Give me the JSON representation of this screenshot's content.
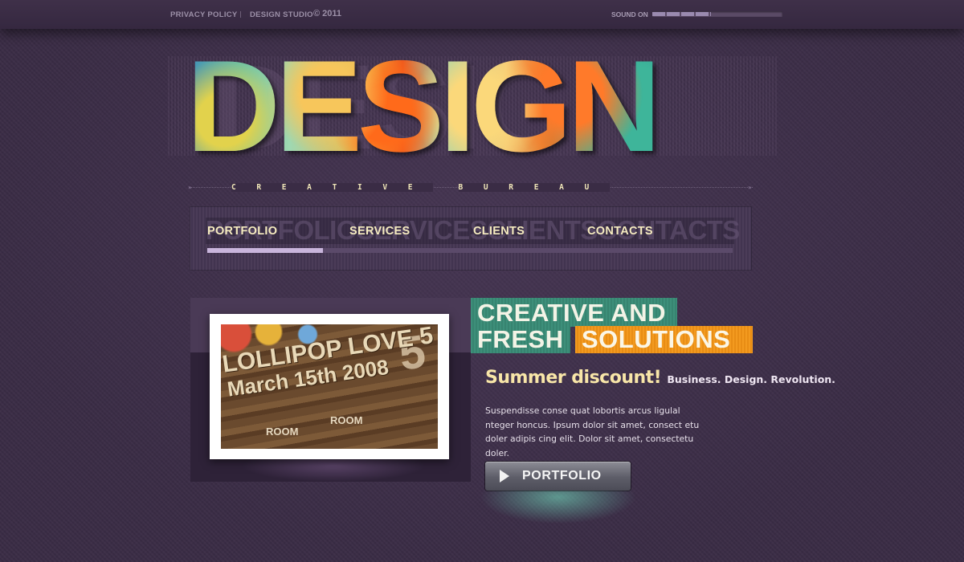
{
  "topbar": {
    "privacy_label": "PRIVACY POLICY",
    "studio_label": "DESIGN STUDIO",
    "copyright": "© 2011",
    "sound_label": "SOUND ON",
    "sound_level": 0.45
  },
  "logo": {
    "text": "DESIGN"
  },
  "tagline": {
    "letters": [
      "C",
      "R",
      "E",
      "A",
      "T",
      "I",
      "V",
      "E",
      "",
      "B",
      "U",
      "R",
      "E",
      "A",
      "U"
    ]
  },
  "nav": {
    "items": [
      {
        "label": "PORTFOLIO"
      },
      {
        "label": "SERVICES"
      },
      {
        "label": "CLIENTS"
      },
      {
        "label": "CONTACTS"
      }
    ],
    "ghost_text": "PORTFOLIOSERVICESCLIENTSCONTACTS",
    "progress": 0.22
  },
  "feature": {
    "photo": {
      "title": "LOLLIPOP LOVE 5",
      "date": "March 15th 2008",
      "room1": "ROOM",
      "room2": "ROOM"
    },
    "headline_line1": "CREATIVE AND",
    "headline_line2a": "FRESH",
    "headline_line2b": "SOLUTIONS",
    "summer_title": "Summer discount!",
    "summer_sub": "Business. Design. Revolution.",
    "body": "Suspendisse conse quat lobortis arcus ligulal nteger honcus. Ipsum dolor sit amet, consect etu doler adipis cing elit. Dolor sit amet, consectetu doler.",
    "button_label": "PORTFOLIO"
  },
  "colors": {
    "background": "#3a2c45",
    "accent_green": "#3d8f7a",
    "accent_orange": "#f39a1f",
    "nav_text": "#f6ecc0"
  }
}
